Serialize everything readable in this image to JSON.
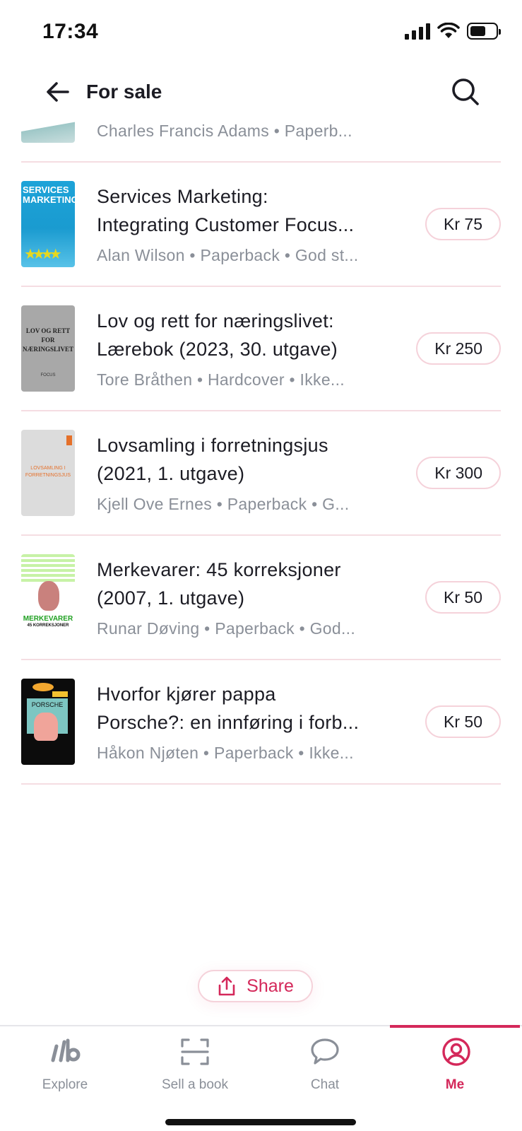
{
  "status_bar": {
    "time": "17:34"
  },
  "header": {
    "title": "For sale",
    "back_icon": "arrow-left-icon",
    "search_icon": "search-icon"
  },
  "partial_item": {
    "meta": "Charles Francis Adams • Paperb..."
  },
  "items": [
    {
      "title_line1": "Services Marketing:",
      "title_line2": "Integrating Customer Focus...",
      "meta": "Alan Wilson • Paperback • God st...",
      "price": "Kr 75",
      "cover": {
        "line1": "SERVICES",
        "line2": "MARKETING"
      }
    },
    {
      "title_line1": "Lov og rett for næringslivet:",
      "title_line2": "Lærebok (2023, 30. utgave)",
      "meta": "Tore Bråthen • Hardcover • Ikke...",
      "price": "Kr 250",
      "cover": {
        "line1": "LOV OG RETT",
        "line2": "FOR",
        "line3": "NÆRINGSLIVET",
        "footer": "FOCUS"
      }
    },
    {
      "title_line1": "Lovsamling i forretningsjus",
      "title_line2": "(2021, 1. utgave)",
      "meta": "Kjell Ove Ernes • Paperback • G...",
      "price": "Kr 300",
      "cover": {
        "line1": "LOVSAMLING I",
        "line2": "FORRETNINGSJUS"
      }
    },
    {
      "title_line1": "Merkevarer: 45 korreksjoner",
      "title_line2": "(2007, 1. utgave)",
      "meta": "Runar Døving • Paperback • God...",
      "price": "Kr 50",
      "cover": {
        "line1": "MERKEVARER",
        "line2": "45 KORREKSJONER"
      }
    },
    {
      "title_line1": "Hvorfor kjører pappa",
      "title_line2": "Porsche?: en innføring i forb...",
      "meta": "Håkon Njøten • Paperback • Ikke...",
      "price": "Kr 50",
      "cover": {
        "line1": "PORSCHE"
      }
    }
  ],
  "share": {
    "label": "Share",
    "icon": "share-icon"
  },
  "tabs": [
    {
      "label": "Explore",
      "icon": "explore-logo-icon",
      "active": false
    },
    {
      "label": "Sell a book",
      "icon": "scan-icon",
      "active": false
    },
    {
      "label": "Chat",
      "icon": "chat-bubble-icon",
      "active": false
    },
    {
      "label": "Me",
      "icon": "user-profile-icon",
      "active": true
    }
  ],
  "colors": {
    "accent": "#d4285a",
    "divider": "#f5dde2",
    "muted_text": "#8a8f98",
    "text": "#1c1c24"
  }
}
